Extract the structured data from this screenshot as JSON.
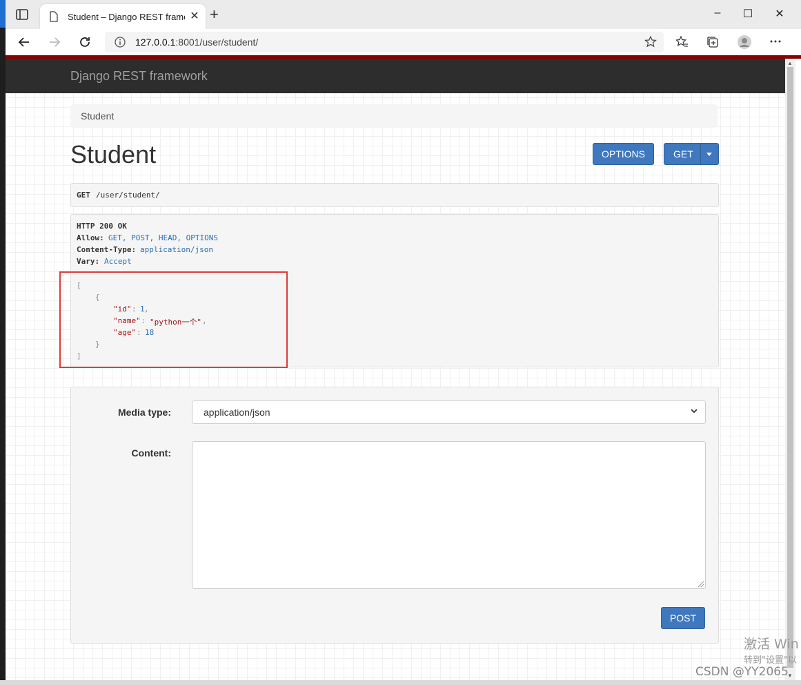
{
  "browser": {
    "tab_title": "Student – Django REST framewo",
    "close_tab": "✕",
    "new_tab": "+",
    "url_host": "127.0.0.1",
    "url_rest": ":8001/user/student/",
    "window_controls": [
      "–",
      "☐",
      "✕"
    ]
  },
  "navbar": {
    "brand": "Django REST framework"
  },
  "breadcrumb": {
    "current": "Student"
  },
  "page": {
    "title": "Student"
  },
  "buttons": {
    "options": "OPTIONS",
    "get": "GET",
    "post": "POST"
  },
  "request": {
    "method": "GET",
    "path": "/user/student/"
  },
  "response": {
    "status_line": "HTTP 200 OK",
    "allow_label": "Allow:",
    "allow_value": "GET, POST, HEAD, OPTIONS",
    "content_type_label": "Content-Type:",
    "content_type_value": "application/json",
    "vary_label": "Vary:",
    "vary_value": "Accept",
    "body": {
      "open_bracket": "[",
      "open_brace": "{",
      "id_key": "\"id\"",
      "id_value": "1",
      "name_key": "\"name\"",
      "name_value": "\"python一个\"",
      "age_key": "\"age\"",
      "age_value": "18",
      "close_brace": "}",
      "close_bracket": "]"
    }
  },
  "form": {
    "media_type_label": "Media type:",
    "media_type_value": "application/json",
    "content_label": "Content:"
  },
  "watermark": {
    "activate": "激活 Win",
    "settings": "转到\"设置\"以",
    "csdn": "CSDN @YY2065"
  }
}
